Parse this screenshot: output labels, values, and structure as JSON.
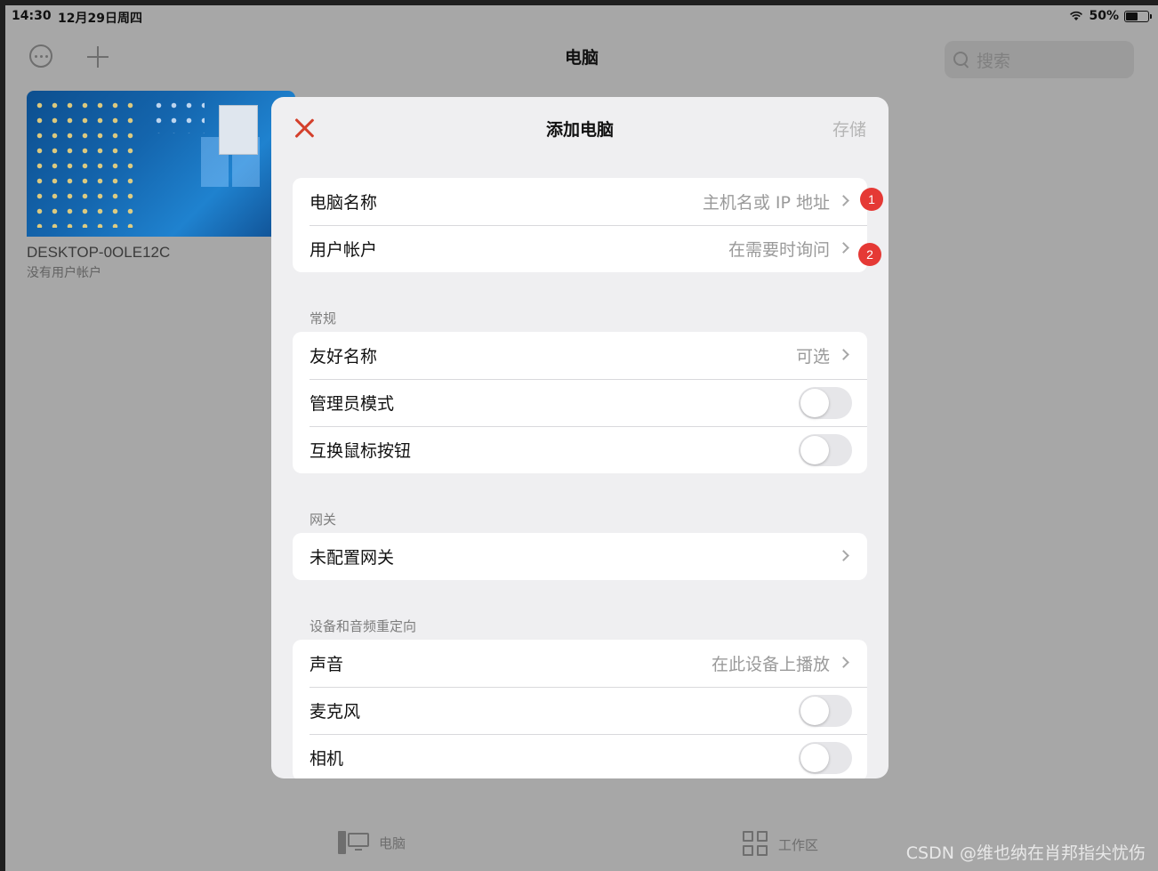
{
  "status_bar": {
    "time": "14:30",
    "date": "12月29日周四",
    "battery": "50%"
  },
  "nav": {
    "title": "电脑",
    "search_placeholder": "搜索"
  },
  "pc_card": {
    "name": "DESKTOP-0OLE12C",
    "user": "没有用户帐户"
  },
  "modal": {
    "title": "添加电脑",
    "save_label": "存储",
    "main_rows": [
      {
        "label": "电脑名称",
        "value": "主机名或 IP 地址"
      },
      {
        "label": "用户帐户",
        "value": "在需要时询问"
      }
    ],
    "general": {
      "header": "常规",
      "friendly_name": {
        "label": "友好名称",
        "value": "可选"
      },
      "admin_mode": {
        "label": "管理员模式",
        "on": false
      },
      "swap_mouse": {
        "label": "互换鼠标按钮",
        "on": false
      }
    },
    "gateway": {
      "header": "网关",
      "row_label": "未配置网关"
    },
    "redirection": {
      "header": "设备和音频重定向",
      "sound": {
        "label": "声音",
        "value": "在此设备上播放"
      },
      "microphone": {
        "label": "麦克风",
        "on": false
      },
      "camera": {
        "label": "相机",
        "on": false
      }
    }
  },
  "annotations": {
    "badge_1": "1",
    "badge_2": "2"
  },
  "tab_bar": {
    "computers": "电脑",
    "workspaces": "工作区"
  },
  "watermark": "CSDN @维也纳在肖邦指尖忧伤",
  "colors": {
    "accent_red": "#d4402c",
    "badge_red": "#e53935",
    "overlay": "#a7a7a7"
  }
}
